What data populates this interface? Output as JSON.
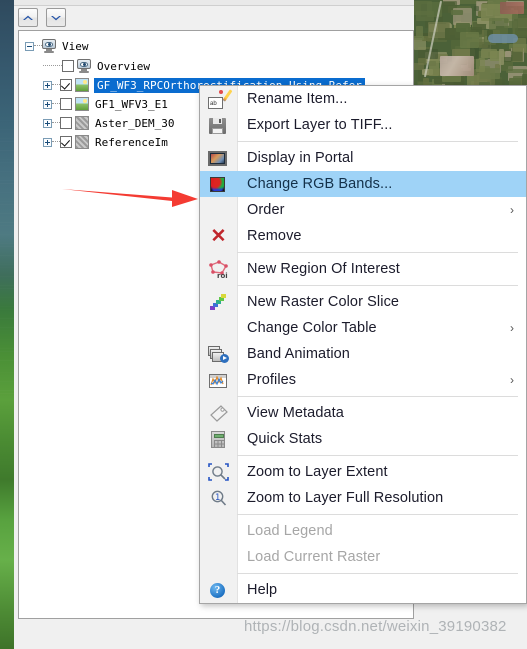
{
  "toolbar": {
    "buttons": [
      {
        "name": "collapse-up-button",
        "icon": "chevron-up-icon"
      },
      {
        "name": "expand-down-button",
        "icon": "chevron-down-icon"
      }
    ]
  },
  "layer_tree": {
    "rows": [
      {
        "label": "View",
        "icon": "monitor-eye-icon",
        "indent": 0,
        "expander": "minus",
        "has_checkbox": false,
        "checked": false,
        "selected": false
      },
      {
        "label": "Overview",
        "icon": "monitor-eye-icon",
        "indent": 1,
        "expander": "none",
        "has_checkbox": true,
        "checked": false,
        "selected": false
      },
      {
        "label": "GF_WF3_RPCOrthorectification_Using_Refer",
        "icon": "raster-layer-icon",
        "indent": 1,
        "expander": "plus",
        "has_checkbox": true,
        "checked": true,
        "selected": true
      },
      {
        "label": "GF1_WFV3_E1",
        "icon": "raster-layer-icon",
        "indent": 1,
        "expander": "plus",
        "has_checkbox": true,
        "checked": false,
        "selected": false
      },
      {
        "label": "Aster_DEM_30",
        "icon": "gray-raster-icon",
        "indent": 1,
        "expander": "plus",
        "has_checkbox": true,
        "checked": false,
        "selected": false
      },
      {
        "label": "ReferenceIm",
        "icon": "gray-raster-icon",
        "indent": 1,
        "expander": "plus",
        "has_checkbox": true,
        "checked": true,
        "selected": false
      }
    ]
  },
  "context_menu": {
    "highlight_color": "#9fd3f7",
    "items": [
      {
        "type": "item",
        "label": "Rename Item...",
        "icon": "rename-icon",
        "submenu": false,
        "disabled": false,
        "selected": false
      },
      {
        "type": "item",
        "label": "Export Layer to TIFF...",
        "icon": "save-disk-icon",
        "submenu": false,
        "disabled": false,
        "selected": false
      },
      {
        "type": "separator"
      },
      {
        "type": "item",
        "label": "Display in Portal",
        "icon": "portal-icon",
        "submenu": false,
        "disabled": false,
        "selected": false
      },
      {
        "type": "item",
        "label": "Change RGB Bands...",
        "icon": "rgb-bands-icon",
        "submenu": false,
        "disabled": false,
        "selected": true
      },
      {
        "type": "item",
        "label": "Order",
        "icon": "none",
        "submenu": true,
        "disabled": false,
        "selected": false
      },
      {
        "type": "item",
        "label": "Remove",
        "icon": "remove-x-icon",
        "submenu": false,
        "disabled": false,
        "selected": false
      },
      {
        "type": "separator"
      },
      {
        "type": "item",
        "label": "New Region Of Interest",
        "icon": "roi-icon",
        "submenu": false,
        "disabled": false,
        "selected": false
      },
      {
        "type": "separator"
      },
      {
        "type": "item",
        "label": "New Raster Color Slice",
        "icon": "color-slice-icon",
        "submenu": false,
        "disabled": false,
        "selected": false
      },
      {
        "type": "item",
        "label": "Change Color Table",
        "icon": "none",
        "submenu": true,
        "disabled": false,
        "selected": false
      },
      {
        "type": "item",
        "label": "Band Animation",
        "icon": "band-animation-icon",
        "submenu": false,
        "disabled": false,
        "selected": false
      },
      {
        "type": "item",
        "label": "Profiles",
        "icon": "profiles-icon",
        "submenu": true,
        "disabled": false,
        "selected": false
      },
      {
        "type": "separator"
      },
      {
        "type": "item",
        "label": "View Metadata",
        "icon": "tag-metadata-icon",
        "submenu": false,
        "disabled": false,
        "selected": false
      },
      {
        "type": "item",
        "label": "Quick Stats",
        "icon": "calculator-icon",
        "submenu": false,
        "disabled": false,
        "selected": false
      },
      {
        "type": "separator"
      },
      {
        "type": "item",
        "label": "Zoom to Layer Extent",
        "icon": "zoom-extent-icon",
        "submenu": false,
        "disabled": false,
        "selected": false
      },
      {
        "type": "item",
        "label": "Zoom to Layer Full Resolution",
        "icon": "zoom-one-icon",
        "submenu": false,
        "disabled": false,
        "selected": false
      },
      {
        "type": "separator"
      },
      {
        "type": "item",
        "label": "Load Legend",
        "icon": "none",
        "submenu": false,
        "disabled": true,
        "selected": false
      },
      {
        "type": "item",
        "label": "Load Current Raster",
        "icon": "none",
        "submenu": false,
        "disabled": true,
        "selected": false
      },
      {
        "type": "separator"
      },
      {
        "type": "item",
        "label": "Help",
        "icon": "help-icon",
        "submenu": false,
        "disabled": false,
        "selected": false
      }
    ],
    "submenu_arrow": "›"
  },
  "annotation": {
    "arrow_color": "#f43b32",
    "points_to": "Change RGB Bands..."
  },
  "watermark": {
    "text": "https://blog.csdn.net/weixin_39190382"
  }
}
